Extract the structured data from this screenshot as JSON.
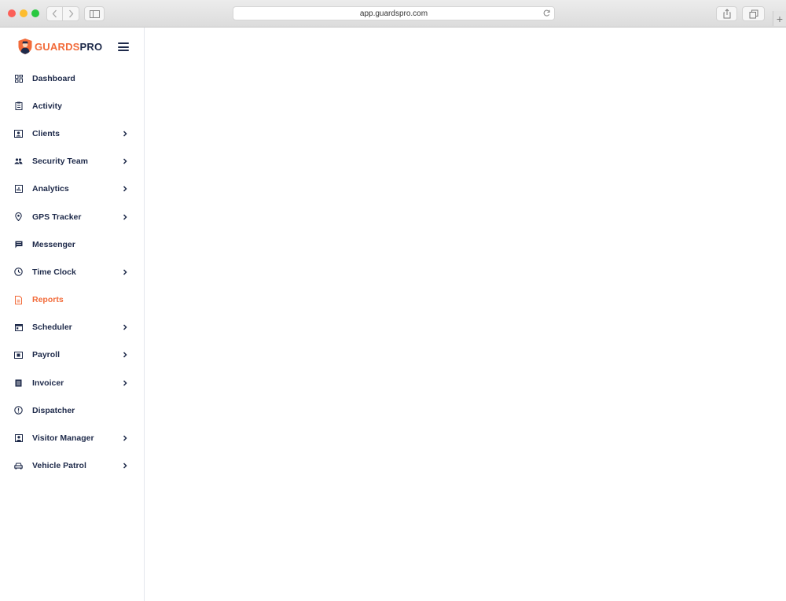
{
  "browser": {
    "url": "app.guardspro.com"
  },
  "brand": {
    "name_part1": "GUARDS",
    "name_part2": "PRO",
    "accent_color": "#f26b3a",
    "text_color": "#1e2a4a"
  },
  "sidebar": {
    "items": [
      {
        "label": "Dashboard",
        "icon": "dashboard-icon",
        "has_submenu": false,
        "active": false
      },
      {
        "label": "Activity",
        "icon": "clipboard-icon",
        "has_submenu": false,
        "active": false
      },
      {
        "label": "Clients",
        "icon": "contact-card-icon",
        "has_submenu": true,
        "active": false
      },
      {
        "label": "Security Team",
        "icon": "people-icon",
        "has_submenu": true,
        "active": false
      },
      {
        "label": "Analytics",
        "icon": "bar-chart-icon",
        "has_submenu": true,
        "active": false
      },
      {
        "label": "GPS Tracker",
        "icon": "location-pin-icon",
        "has_submenu": true,
        "active": false
      },
      {
        "label": "Messenger",
        "icon": "message-icon",
        "has_submenu": false,
        "active": false
      },
      {
        "label": "Time Clock",
        "icon": "clock-icon",
        "has_submenu": true,
        "active": false
      },
      {
        "label": "Reports",
        "icon": "document-icon",
        "has_submenu": false,
        "active": true
      },
      {
        "label": "Scheduler",
        "icon": "calendar-icon",
        "has_submenu": true,
        "active": false
      },
      {
        "label": "Payroll",
        "icon": "money-icon",
        "has_submenu": true,
        "active": false
      },
      {
        "label": "Invoicer",
        "icon": "invoice-icon",
        "has_submenu": true,
        "active": false
      },
      {
        "label": "Dispatcher",
        "icon": "alert-icon",
        "has_submenu": false,
        "active": false
      },
      {
        "label": "Visitor Manager",
        "icon": "visitor-icon",
        "has_submenu": true,
        "active": false
      },
      {
        "label": "Vehicle Patrol",
        "icon": "car-icon",
        "has_submenu": true,
        "active": false
      }
    ]
  }
}
